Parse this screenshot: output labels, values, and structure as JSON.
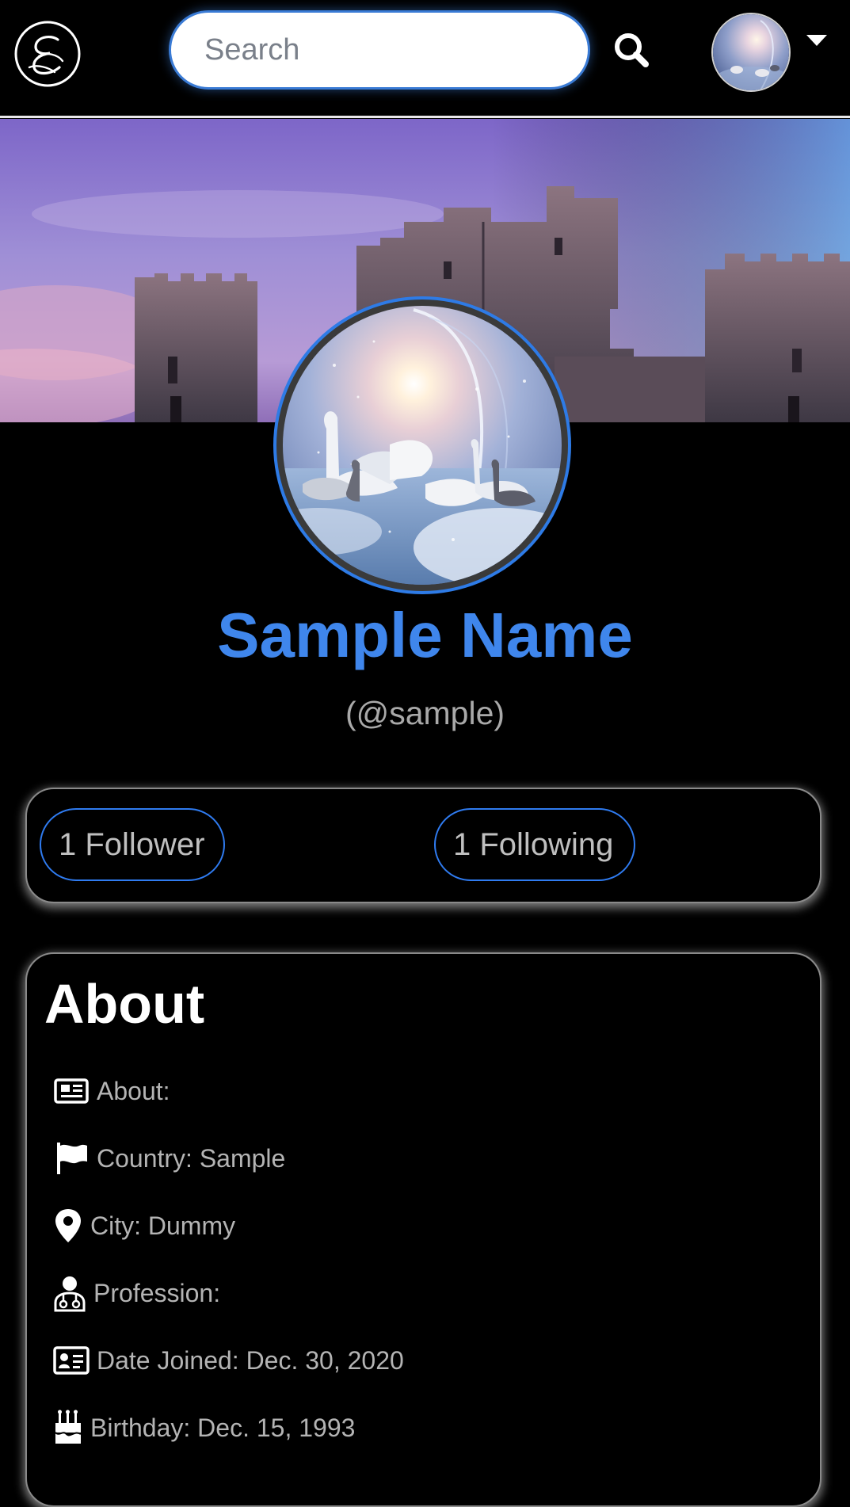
{
  "header": {
    "logo_icon": "script-e-logo-icon",
    "search": {
      "placeholder": "Search",
      "value": "",
      "button_icon": "search-icon"
    },
    "user_menu": {
      "avatar": "user-avatar-swans",
      "dropdown_icon": "caret-down-icon"
    }
  },
  "profile": {
    "banner": "castle-ruins-banner",
    "avatar": "profile-avatar-swans",
    "name": "Sample Name",
    "handle": "(@sample)",
    "colors": {
      "name": "#3f86ec",
      "accent_border": "#2f7bf0"
    }
  },
  "follow": {
    "followers_label": "1 Follower",
    "following_label": "1 Following"
  },
  "about": {
    "title": "About",
    "items": [
      {
        "icon": "newspaper-icon",
        "text": "About:"
      },
      {
        "icon": "flag-icon",
        "text": "Country: Sample"
      },
      {
        "icon": "map-marker-icon",
        "text": "City: Dummy"
      },
      {
        "icon": "user-doctor-icon",
        "text": "Profession:"
      },
      {
        "icon": "id-card-icon",
        "text": "Date Joined: Dec. 30, 2020"
      },
      {
        "icon": "birthday-cake-icon",
        "text": "Birthday: Dec. 15, 1993"
      }
    ]
  }
}
